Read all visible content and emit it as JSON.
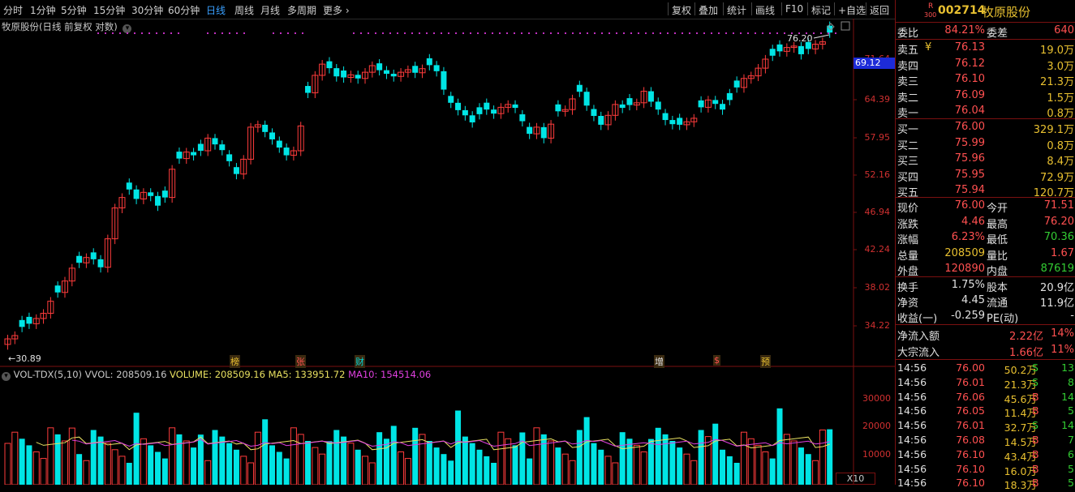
{
  "toolbar": {
    "periods": [
      "分时",
      "1分钟",
      "5分钟",
      "15分钟",
      "30分钟",
      "60分钟",
      "日线",
      "周线",
      "月线",
      "多周期",
      "更多"
    ],
    "active_period": "日线",
    "actions": [
      "复权",
      "叠加",
      "统计",
      "画线",
      "F10",
      "标记",
      "+自选",
      "返回"
    ]
  },
  "chart": {
    "title": "牧原股份(日线 前复权 对数)",
    "y_ticks": [
      "71.64",
      "64.39",
      "57.95",
      "52.16",
      "46.94",
      "42.24",
      "38.02",
      "34.22"
    ],
    "current_price_tag": "69.12",
    "high_label": "76.20",
    "low_label": "30.89",
    "event_markers": [
      {
        "label": "榜",
        "color": "#e8c030"
      },
      {
        "label": "张",
        "color": "#ff5050"
      },
      {
        "label": "财",
        "color": "#00d5d5"
      },
      {
        "label": "增",
        "color": "#e0e0e0"
      },
      {
        "label": "$",
        "color": "#ff5050"
      },
      {
        "label": "预",
        "color": "#e8c030"
      }
    ]
  },
  "volume": {
    "indicator": "VOL-TDX(5,10)",
    "vvol": "VVOL: 208509.16",
    "volume": "VOLUME: 208509.16",
    "ma5": "MA5: 133951.72",
    "ma10": "MA10: 154514.06",
    "y_ticks": [
      "30000",
      "20000",
      "10000"
    ],
    "unit": "X10"
  },
  "chart_data": {
    "type": "candlestick",
    "title": "牧原股份(日线 前复权 对数)",
    "ylim": [
      30.89,
      76.2
    ],
    "ohlc_close_approx": [
      31.5,
      31.8,
      32.6,
      32.9,
      33.4,
      33.9,
      35.1,
      36.0,
      37.2,
      38.6,
      39.2,
      39.8,
      39.6,
      38.7,
      42.0,
      45.9,
      47.3,
      48.4,
      47.1,
      48.0,
      47.5,
      46.2,
      47.3,
      51.3,
      52.9,
      53.9,
      53.4,
      54.1,
      56.1,
      55.1,
      54.2,
      52.5,
      50.6,
      52.8,
      57.9,
      58.3,
      57.1,
      55.9,
      54.6,
      53.4,
      54.1,
      58.1,
      63.9,
      67.2,
      69.4,
      68.6,
      67.0,
      66.8,
      67.3,
      66.6,
      67.8,
      69.1,
      68.2,
      67.5,
      67.0,
      67.8,
      68.3,
      67.7,
      68.5,
      69.2,
      68.0,
      64.5,
      62.1,
      60.8,
      59.9,
      58.7,
      60.1,
      60.9,
      60.2,
      61.3,
      61.8,
      61.2,
      58.9,
      56.8,
      57.9,
      56.1,
      58.4,
      60.6,
      60.9,
      62.8,
      64.1,
      61.6,
      59.8,
      58.3,
      59.9,
      61.8,
      61.2,
      61.7,
      62.1,
      64.2,
      62.3,
      60.9,
      59.1,
      58.4,
      58.3,
      58.8,
      59.4,
      61.3,
      62.6,
      61.9,
      60.9,
      62.6,
      64.9,
      66.6,
      67.1,
      68.6,
      70.4,
      71.1,
      72.0,
      72.8,
      73.1,
      71.4,
      72.5,
      73.5,
      74.0,
      76.0
    ],
    "last_close": 76.0
  },
  "quote": {
    "badge_top": "R",
    "badge_bottom": "300",
    "code": "002714",
    "name": "牧原股份",
    "weibi_label": "委比",
    "weibi": "84.21%",
    "weicha_label": "委差",
    "weicha": "640",
    "asks": [
      {
        "label": "卖五",
        "flag": "¥",
        "price": "76.13",
        "vol": "19.0万"
      },
      {
        "label": "卖四",
        "flag": "",
        "price": "76.12",
        "vol": "3.0万"
      },
      {
        "label": "卖三",
        "flag": "",
        "price": "76.10",
        "vol": "21.3万"
      },
      {
        "label": "卖二",
        "flag": "",
        "price": "76.09",
        "vol": "1.5万"
      },
      {
        "label": "卖一",
        "flag": "",
        "price": "76.04",
        "vol": "0.8万"
      }
    ],
    "bids": [
      {
        "label": "买一",
        "price": "76.00",
        "vol": "329.1万"
      },
      {
        "label": "买二",
        "price": "75.99",
        "vol": "0.8万"
      },
      {
        "label": "买三",
        "price": "75.96",
        "vol": "8.4万"
      },
      {
        "label": "买四",
        "price": "75.95",
        "vol": "72.9万"
      },
      {
        "label": "买五",
        "price": "75.94",
        "vol": "120.7万"
      }
    ],
    "stats": [
      {
        "l1": "现价",
        "v1": "76.00",
        "c1": "r",
        "l2": "今开",
        "v2": "71.51",
        "c2": "r"
      },
      {
        "l1": "涨跌",
        "v1": "4.46",
        "c1": "r",
        "l2": "最高",
        "v2": "76.20",
        "c2": "r"
      },
      {
        "l1": "涨幅",
        "v1": "6.23%",
        "c1": "r",
        "l2": "最低",
        "v2": "70.36",
        "c2": "g"
      },
      {
        "l1": "总量",
        "v1": "208509",
        "c1": "y",
        "l2": "量比",
        "v2": "1.67",
        "c2": "r"
      },
      {
        "l1": "外盘",
        "v1": "120890",
        "c1": "r",
        "l2": "内盘",
        "v2": "87619",
        "c2": "g"
      }
    ],
    "stats2": [
      {
        "l1": "换手",
        "v1": "1.75%",
        "c1": "w",
        "l2": "股本",
        "v2": "20.9亿",
        "c2": "w"
      },
      {
        "l1": "净资",
        "v1": "4.45",
        "c1": "w",
        "l2": "流通",
        "v2": "11.9亿",
        "c2": "w"
      },
      {
        "l1": "收益(一)",
        "v1": "-0.259",
        "c1": "w",
        "l2": "PE(动)",
        "v2": "-",
        "c2": "w"
      }
    ],
    "flows": [
      {
        "label": "净流入额",
        "value": "2.22亿",
        "pct": "14%"
      },
      {
        "label": "大宗流入",
        "value": "1.66亿",
        "pct": "11%"
      }
    ],
    "ticks": [
      {
        "time": "14:56",
        "price": "76.00",
        "vol": "50.2万",
        "side": "S",
        "n": "13"
      },
      {
        "time": "14:56",
        "price": "76.01",
        "vol": "21.3万",
        "side": "S",
        "n": "8"
      },
      {
        "time": "14:56",
        "price": "76.06",
        "vol": "45.6万",
        "side": "B",
        "n": "14"
      },
      {
        "time": "14:56",
        "price": "76.05",
        "vol": "11.4万",
        "side": "B",
        "n": "5"
      },
      {
        "time": "14:56",
        "price": "76.01",
        "vol": "32.7万",
        "side": "S",
        "n": "14"
      },
      {
        "time": "14:56",
        "price": "76.08",
        "vol": "14.5万",
        "side": "B",
        "n": "7"
      },
      {
        "time": "14:56",
        "price": "76.10",
        "vol": "43.4万",
        "side": "B",
        "n": "6"
      },
      {
        "time": "14:56",
        "price": "76.10",
        "vol": "16.0万",
        "side": "B",
        "n": "5"
      },
      {
        "time": "14:56",
        "price": "76.10",
        "vol": "18.3万",
        "side": "B",
        "n": "5"
      }
    ]
  }
}
